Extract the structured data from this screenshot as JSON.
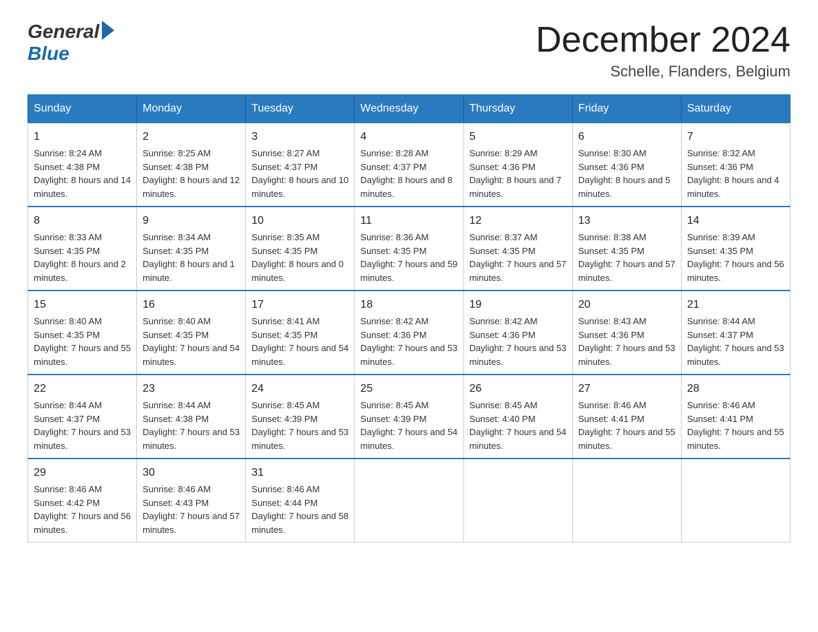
{
  "header": {
    "logo_general": "General",
    "logo_blue": "Blue",
    "month_title": "December 2024",
    "location": "Schelle, Flanders, Belgium"
  },
  "weekdays": [
    "Sunday",
    "Monday",
    "Tuesday",
    "Wednesday",
    "Thursday",
    "Friday",
    "Saturday"
  ],
  "weeks": [
    [
      {
        "day": "1",
        "sunrise": "8:24 AM",
        "sunset": "4:38 PM",
        "daylight": "8 hours and 14 minutes."
      },
      {
        "day": "2",
        "sunrise": "8:25 AM",
        "sunset": "4:38 PM",
        "daylight": "8 hours and 12 minutes."
      },
      {
        "day": "3",
        "sunrise": "8:27 AM",
        "sunset": "4:37 PM",
        "daylight": "8 hours and 10 minutes."
      },
      {
        "day": "4",
        "sunrise": "8:28 AM",
        "sunset": "4:37 PM",
        "daylight": "8 hours and 8 minutes."
      },
      {
        "day": "5",
        "sunrise": "8:29 AM",
        "sunset": "4:36 PM",
        "daylight": "8 hours and 7 minutes."
      },
      {
        "day": "6",
        "sunrise": "8:30 AM",
        "sunset": "4:36 PM",
        "daylight": "8 hours and 5 minutes."
      },
      {
        "day": "7",
        "sunrise": "8:32 AM",
        "sunset": "4:36 PM",
        "daylight": "8 hours and 4 minutes."
      }
    ],
    [
      {
        "day": "8",
        "sunrise": "8:33 AM",
        "sunset": "4:35 PM",
        "daylight": "8 hours and 2 minutes."
      },
      {
        "day": "9",
        "sunrise": "8:34 AM",
        "sunset": "4:35 PM",
        "daylight": "8 hours and 1 minute."
      },
      {
        "day": "10",
        "sunrise": "8:35 AM",
        "sunset": "4:35 PM",
        "daylight": "8 hours and 0 minutes."
      },
      {
        "day": "11",
        "sunrise": "8:36 AM",
        "sunset": "4:35 PM",
        "daylight": "7 hours and 59 minutes."
      },
      {
        "day": "12",
        "sunrise": "8:37 AM",
        "sunset": "4:35 PM",
        "daylight": "7 hours and 57 minutes."
      },
      {
        "day": "13",
        "sunrise": "8:38 AM",
        "sunset": "4:35 PM",
        "daylight": "7 hours and 57 minutes."
      },
      {
        "day": "14",
        "sunrise": "8:39 AM",
        "sunset": "4:35 PM",
        "daylight": "7 hours and 56 minutes."
      }
    ],
    [
      {
        "day": "15",
        "sunrise": "8:40 AM",
        "sunset": "4:35 PM",
        "daylight": "7 hours and 55 minutes."
      },
      {
        "day": "16",
        "sunrise": "8:40 AM",
        "sunset": "4:35 PM",
        "daylight": "7 hours and 54 minutes."
      },
      {
        "day": "17",
        "sunrise": "8:41 AM",
        "sunset": "4:35 PM",
        "daylight": "7 hours and 54 minutes."
      },
      {
        "day": "18",
        "sunrise": "8:42 AM",
        "sunset": "4:36 PM",
        "daylight": "7 hours and 53 minutes."
      },
      {
        "day": "19",
        "sunrise": "8:42 AM",
        "sunset": "4:36 PM",
        "daylight": "7 hours and 53 minutes."
      },
      {
        "day": "20",
        "sunrise": "8:43 AM",
        "sunset": "4:36 PM",
        "daylight": "7 hours and 53 minutes."
      },
      {
        "day": "21",
        "sunrise": "8:44 AM",
        "sunset": "4:37 PM",
        "daylight": "7 hours and 53 minutes."
      }
    ],
    [
      {
        "day": "22",
        "sunrise": "8:44 AM",
        "sunset": "4:37 PM",
        "daylight": "7 hours and 53 minutes."
      },
      {
        "day": "23",
        "sunrise": "8:44 AM",
        "sunset": "4:38 PM",
        "daylight": "7 hours and 53 minutes."
      },
      {
        "day": "24",
        "sunrise": "8:45 AM",
        "sunset": "4:39 PM",
        "daylight": "7 hours and 53 minutes."
      },
      {
        "day": "25",
        "sunrise": "8:45 AM",
        "sunset": "4:39 PM",
        "daylight": "7 hours and 54 minutes."
      },
      {
        "day": "26",
        "sunrise": "8:45 AM",
        "sunset": "4:40 PM",
        "daylight": "7 hours and 54 minutes."
      },
      {
        "day": "27",
        "sunrise": "8:46 AM",
        "sunset": "4:41 PM",
        "daylight": "7 hours and 55 minutes."
      },
      {
        "day": "28",
        "sunrise": "8:46 AM",
        "sunset": "4:41 PM",
        "daylight": "7 hours and 55 minutes."
      }
    ],
    [
      {
        "day": "29",
        "sunrise": "8:46 AM",
        "sunset": "4:42 PM",
        "daylight": "7 hours and 56 minutes."
      },
      {
        "day": "30",
        "sunrise": "8:46 AM",
        "sunset": "4:43 PM",
        "daylight": "7 hours and 57 minutes."
      },
      {
        "day": "31",
        "sunrise": "8:46 AM",
        "sunset": "4:44 PM",
        "daylight": "7 hours and 58 minutes."
      },
      null,
      null,
      null,
      null
    ]
  ]
}
